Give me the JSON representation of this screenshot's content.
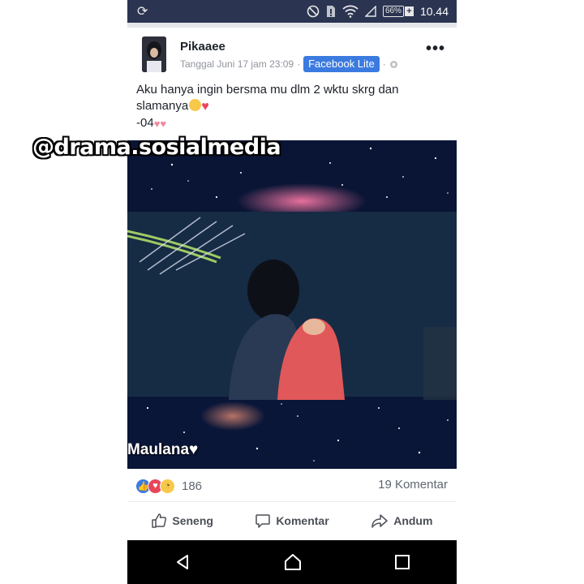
{
  "status_bar": {
    "time": "10.44",
    "battery": "66%",
    "battery_charging": "+",
    "left_icon": "sync-icon",
    "right_icons": [
      "dnd-icon",
      "sim-icon",
      "wifi-icon",
      "signal-icon",
      "battery-icon"
    ]
  },
  "post": {
    "author": "Pikaaee",
    "timestamp": "Tanggal Juni 17 jam 23:09",
    "separator": "·",
    "app_badge": "Facebook Lite",
    "privacy_icon": "globe-icon",
    "more_label": "•••",
    "text_line1": "Aku hanya ingin bersma mu dlm 2 wktu skrg dan",
    "text_line2": "slamanya",
    "text_line3": "-04",
    "photo_signature": "Maulana♥"
  },
  "reactions": {
    "icons": [
      "like-icon",
      "love-icon",
      "sad-icon"
    ],
    "count": "186",
    "comments": "19 Komentar"
  },
  "actions": {
    "like": "Seneng",
    "comment": "Komentar",
    "share": "Andum"
  },
  "watermark": "@drama.sosialmedia",
  "colors": {
    "status_bar": "#2b3552",
    "badge": "#3b7be0",
    "love": "#e8455a",
    "nav_bar": "#000000"
  }
}
